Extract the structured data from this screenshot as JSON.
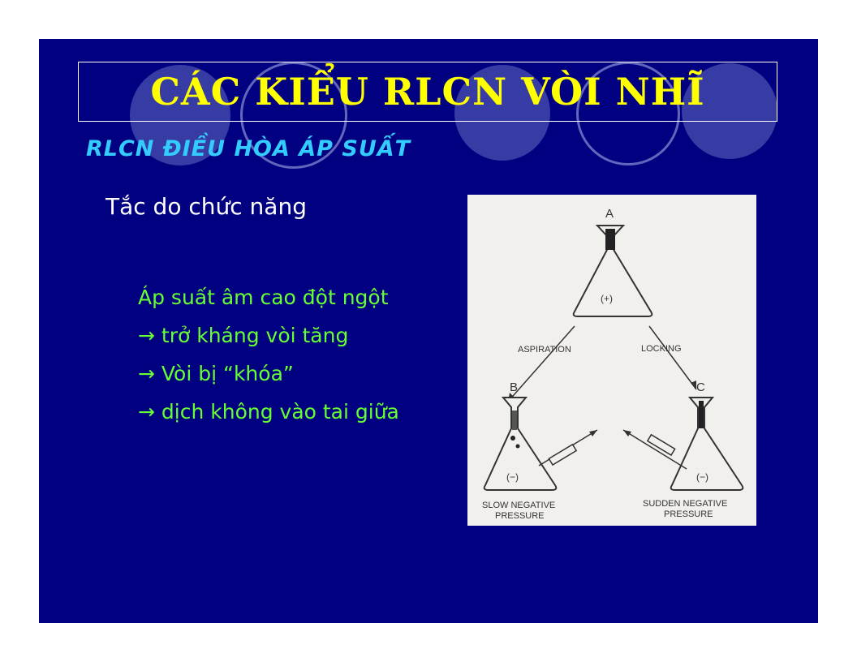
{
  "slide": {
    "title": "CÁC KIỂU RLCN VÒI NHĨ",
    "subtitle": "RLCN ĐIỀU HÒA ÁP SUẤT",
    "heading": "Tắc do chức năng",
    "bullets": [
      "Áp suất âm cao đột ngột",
      "→ trở kháng vòi tăng",
      "→ Vòi bị “khóa”",
      "→ dịch không vào tai giữa"
    ]
  },
  "diagram": {
    "label_a": "A",
    "label_b": "B",
    "label_c": "C",
    "plus_sign": "(+)",
    "minus_b": "(−)",
    "minus_c": "(−)",
    "aspiration": "ASPIRATION",
    "locking": "LOCKING",
    "slow_line1": "SLOW NEGATIVE",
    "slow_line2": "PRESSURE",
    "sudden_line1": "SUDDEN NEGATIVE",
    "sudden_line2": "PRESSURE"
  },
  "colors": {
    "background": "#000080",
    "title": "#ffff00",
    "subtitle": "#33ccff",
    "heading": "#ffffff",
    "bullets": "#66ff33"
  }
}
